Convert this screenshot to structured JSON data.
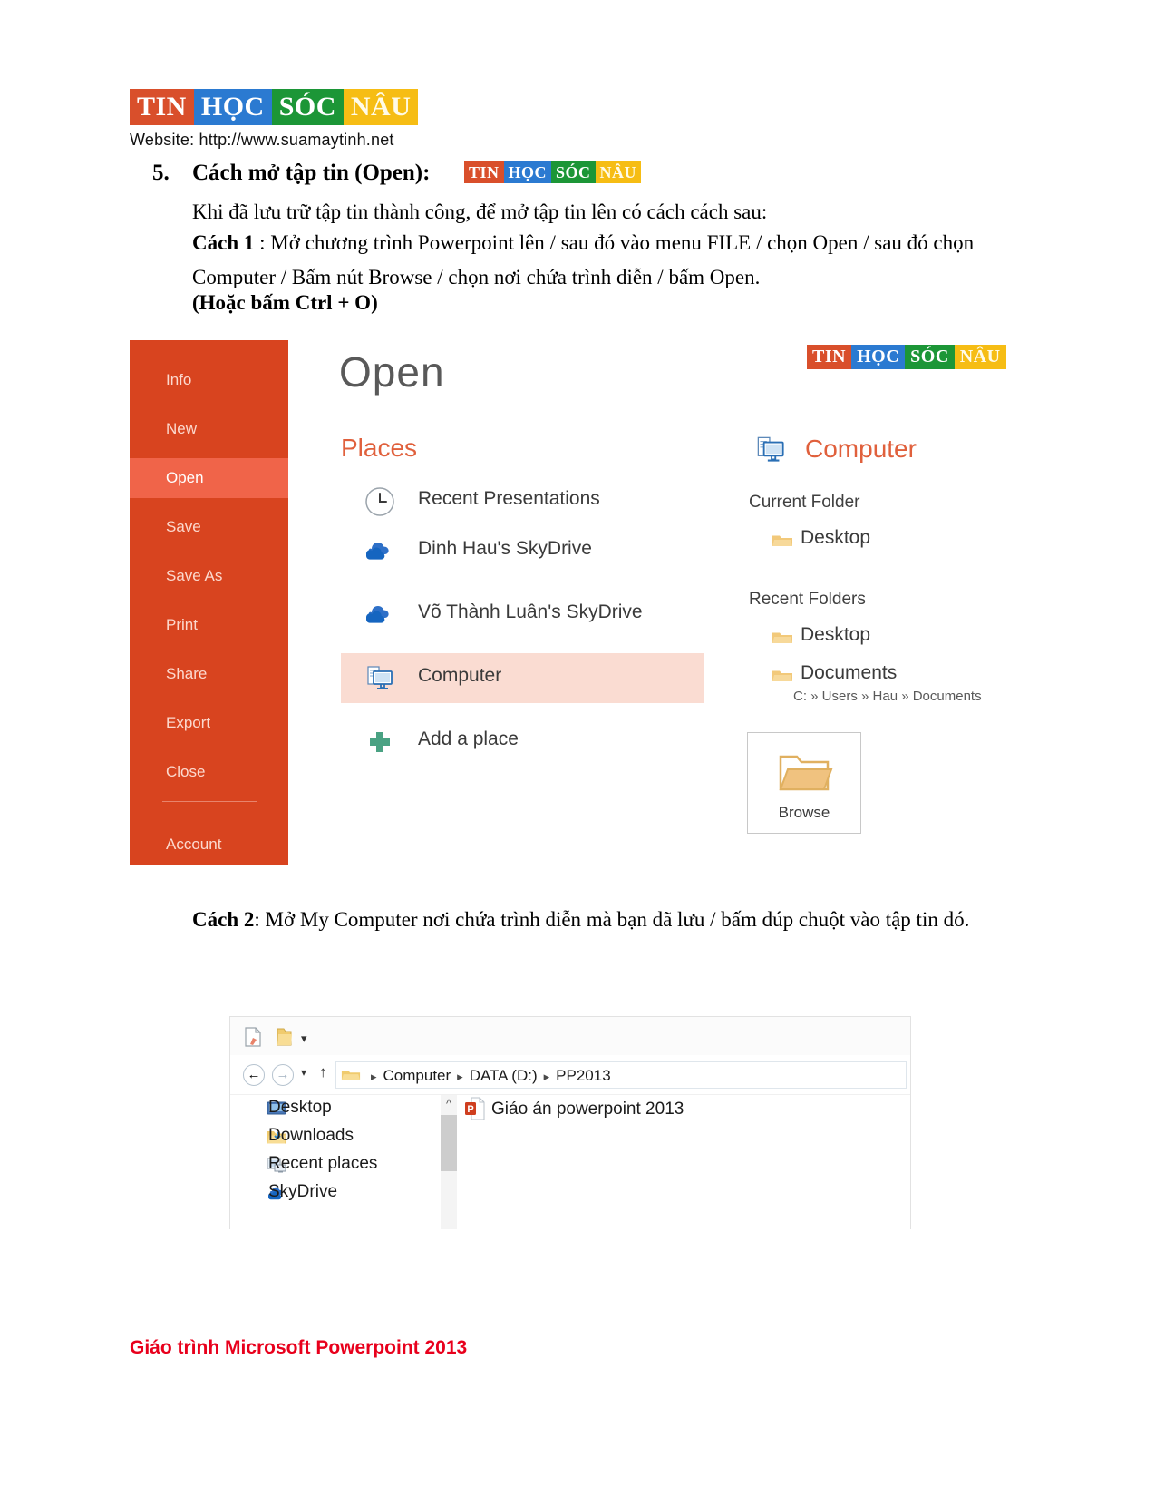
{
  "header": {
    "logo": {
      "parts": [
        "TIN",
        "HỌC",
        "SÓC",
        "NÂU"
      ],
      "colors": {
        "tin": "#d94f2b",
        "hoc": "#2b7ad1",
        "soc": "#1c9637",
        "nau": "#f6bd14"
      }
    },
    "website_line": "Website:  http://www.suamaytinh.net"
  },
  "doc": {
    "section_number": "5.",
    "section_title": "Cách mở tập tin (Open):",
    "intro": "Khi đã lưu trữ tập tin thành công, để mở tập tin lên có cách cách sau:",
    "way1_label": "Cách 1",
    "way1_text": " : Mở chương trình Powerpoint lên / sau đó vào menu FILE / chọn Open / sau đó chọn Computer / Bấm nút Browse / chọn nơi chứa trình diễn / bấm Open.",
    "way1_note": "(Hoặc bấm Ctrl + O)",
    "way2_label": "Cách 2",
    "way2_text": ": Mở My Computer nơi chứa trình diễn mà bạn đã lưu / bấm đúp chuột vào tập tin đó."
  },
  "powerpoint": {
    "title": "Open",
    "sidebar": [
      {
        "label": "Info",
        "active": false
      },
      {
        "label": "New",
        "active": false
      },
      {
        "label": "Open",
        "active": true
      },
      {
        "label": "Save",
        "active": false
      },
      {
        "label": "Save As",
        "active": false
      },
      {
        "label": "Print",
        "active": false
      },
      {
        "label": "Share",
        "active": false
      },
      {
        "label": "Export",
        "active": false
      },
      {
        "label": "Close",
        "active": false
      },
      {
        "label": "Account",
        "active": false
      }
    ],
    "places_header": "Places",
    "places": [
      {
        "label": "Recent Presentations",
        "icon": "clock-icon",
        "selected": false
      },
      {
        "label": "Dinh Hau's SkyDrive",
        "icon": "cloud-icon",
        "selected": false
      },
      {
        "label": "Võ Thành Luân's SkyDrive",
        "icon": "cloud-icon",
        "selected": false
      },
      {
        "label": "Computer",
        "icon": "computer-icon",
        "selected": true
      },
      {
        "label": "Add a place",
        "icon": "plus-icon",
        "selected": false
      }
    ],
    "computer_header": "Computer",
    "current_folder_label": "Current Folder",
    "current_folder": {
      "name": "Desktop"
    },
    "recent_folders_label": "Recent Folders",
    "recent_folders": [
      {
        "name": "Desktop",
        "path": ""
      },
      {
        "name": "Documents",
        "path": "C: » Users » Hau » Documents"
      }
    ],
    "browse_label": "Browse",
    "accent_color": "#d8441f",
    "accent_active": "#f06449",
    "highlight_color": "#fadcd2"
  },
  "explorer": {
    "quick_access_icons": [
      "properties-icon",
      "new-folder-icon",
      "customize-caret-icon"
    ],
    "nav_back": "←",
    "nav_forward": "→",
    "nav_history_caret": "▾",
    "nav_up": "↑",
    "breadcrumb": [
      "Computer",
      "DATA (D:)",
      "PP2013"
    ],
    "breadcrumb_separator": "▸",
    "nav_pane": [
      {
        "label": "Desktop",
        "icon": "desktop-icon"
      },
      {
        "label": "Downloads",
        "icon": "downloads-icon"
      },
      {
        "label": "Recent places",
        "icon": "recent-places-icon"
      },
      {
        "label": "SkyDrive",
        "icon": "skydrive-icon"
      }
    ],
    "files": [
      {
        "name": "Giáo án powerpoint 2013",
        "icon": "powerpoint-file-icon"
      }
    ]
  },
  "footer": {
    "text": "Giáo trình Microsoft Powerpoint 2013",
    "color": "#e8001c"
  }
}
